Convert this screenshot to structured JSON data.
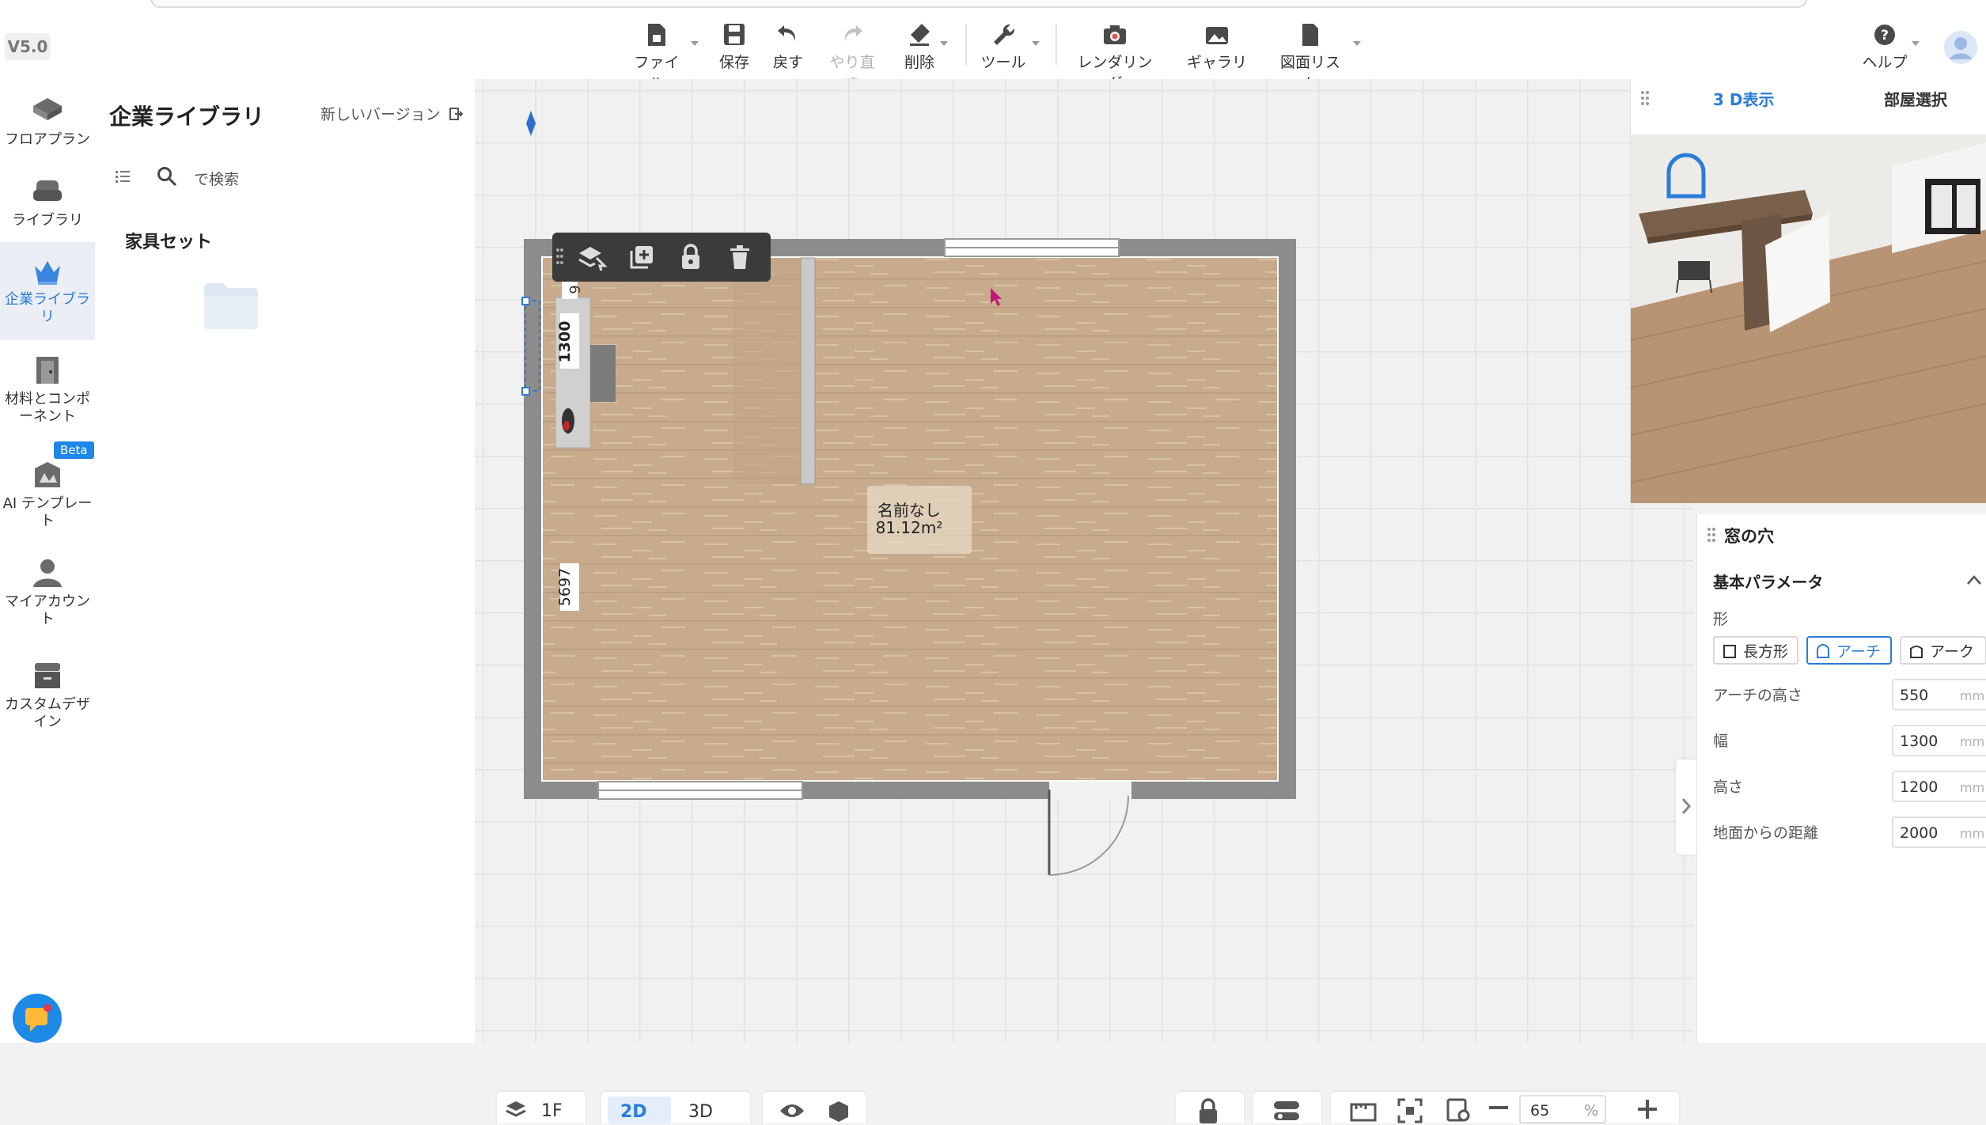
{
  "app": {
    "version": "V5.0"
  },
  "toolbar": {
    "file": "ファイル",
    "save": "保存",
    "undo": "戻す",
    "redo": "やり直す",
    "delete": "削除",
    "tools": "ツール",
    "rendering": "レンダリング",
    "gallery": "ギャラリー",
    "drawing_list": "図面リスト",
    "help": "ヘルプ"
  },
  "sidebar": {
    "items": [
      {
        "label": "フロアプラン",
        "icon": "floorplan-icon"
      },
      {
        "label": "ライブラリ",
        "icon": "sofa-icon"
      },
      {
        "label": "企業ライブラリ",
        "icon": "crown-icon",
        "active": true
      },
      {
        "label": "材料とコンポーネント",
        "icon": "door-icon"
      },
      {
        "label": "AI テンプレート",
        "icon": "ai-template-icon",
        "badge": "Beta"
      },
      {
        "label": "マイアカウント",
        "icon": "user-icon"
      },
      {
        "label": "カスタムデザイン",
        "icon": "cabinet-icon"
      }
    ]
  },
  "library_panel": {
    "title": "企業ライブラリ",
    "new_version_link": "新しいバージョン",
    "search_placeholder": "で検索",
    "section_title": "家具セット"
  },
  "canvas": {
    "room_name": "名前なし",
    "room_area": "81.12m²",
    "dim_top": "6",
    "dim_window": "1300",
    "dim_wall": "5697"
  },
  "view_panel": {
    "tab_3d": "3 D表示",
    "tab_room": "部屋選択"
  },
  "properties": {
    "title": "窓の穴",
    "section": "基本パラメータ",
    "shape_label": "形",
    "shapes": [
      "長方形",
      "アーチ",
      "アーク"
    ],
    "selected_shape": "アーチ",
    "fields": [
      {
        "label": "アーチの高さ",
        "value": "550",
        "unit": "mm"
      },
      {
        "label": "幅",
        "value": "1300",
        "unit": "mm"
      },
      {
        "label": "高さ",
        "value": "1200",
        "unit": "mm"
      },
      {
        "label": "地面からの距離",
        "value": "2000",
        "unit": "mm"
      }
    ]
  },
  "bottombar": {
    "floor": "1F",
    "view_2d": "2D",
    "view_3d": "3D",
    "zoom": "65",
    "zoom_unit": "%"
  },
  "colors": {
    "accent": "#2b7cd8",
    "wall": "#8a8a8a",
    "floor": "#c6a98a"
  }
}
